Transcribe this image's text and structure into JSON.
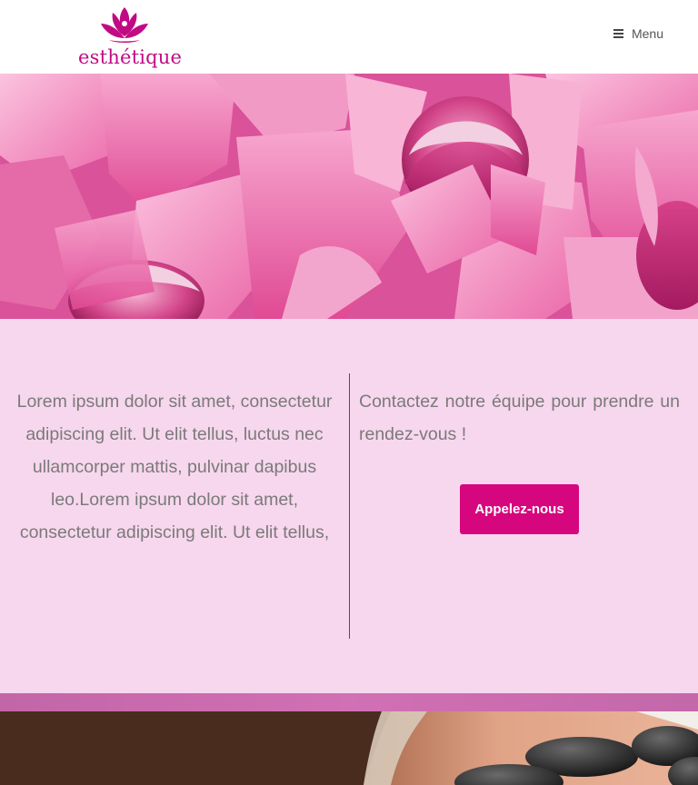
{
  "header": {
    "logo_text": "esthétique",
    "menu_label": "Menu"
  },
  "hero": {
    "image": "pink-lotus-flowers"
  },
  "content": {
    "left_text": "Lorem ipsum dolor sit amet, consectetur adipiscing elit. Ut elit tellus, luctus nec ullamcorper mattis, pulvinar dapibus leo.Lorem ipsum dolor sit amet, consectetur adipiscing elit. Ut elit tellus,",
    "right_text": "Contactez notre équipe pour prendre un rendez-vous !",
    "button_label": "Appelez-nous"
  },
  "bottom": {
    "image": "hot-stone-massage"
  },
  "colors": {
    "brand": "#c10b84",
    "button": "#d6067e",
    "section_bg": "#f7d7ed",
    "text": "#7a7a7a"
  }
}
